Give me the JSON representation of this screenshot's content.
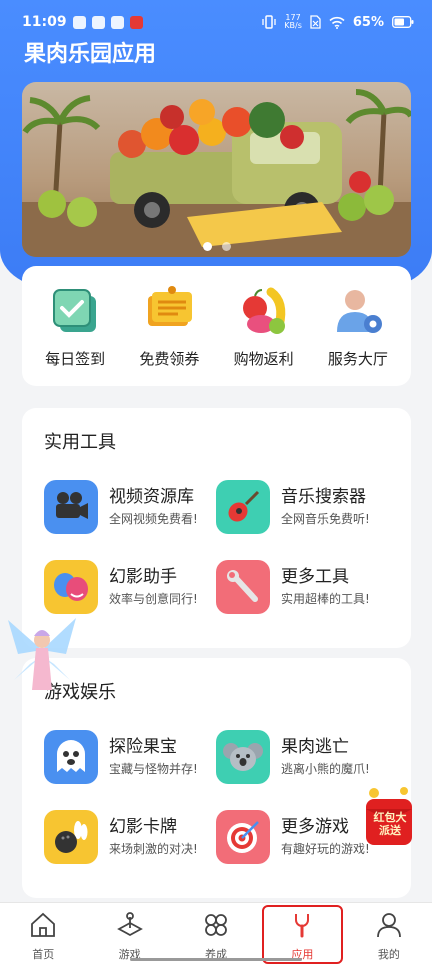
{
  "status_bar": {
    "time": "11:09",
    "net_speed": "177",
    "net_unit": "KB/s",
    "battery": "65%"
  },
  "app": {
    "title": "果肉乐园应用"
  },
  "banner": {
    "slides": 2,
    "active_index": 0
  },
  "quick_actions": [
    {
      "label": "每日签到",
      "icon": "checkin-icon"
    },
    {
      "label": "免费领券",
      "icon": "coupon-icon"
    },
    {
      "label": "购物返利",
      "icon": "fruit-basket-icon"
    },
    {
      "label": "服务大厅",
      "icon": "service-user-icon"
    }
  ],
  "tools_section": {
    "title": "实用工具",
    "items": [
      {
        "name": "视频资源库",
        "desc": "全网视频免费看!",
        "icon": "video-camera-icon",
        "color": "#4a90f0"
      },
      {
        "name": "音乐搜索器",
        "desc": "全网音乐免费听!",
        "icon": "guitar-icon",
        "color": "#3ecfb2"
      },
      {
        "name": "幻影助手",
        "desc": "效率与创意同行!",
        "icon": "masks-icon",
        "color": "#f7c531"
      },
      {
        "name": "更多工具",
        "desc": "实用超棒的工具!",
        "icon": "wrench-icon",
        "color": "#f26d78"
      }
    ]
  },
  "games_section": {
    "title": "游戏娱乐",
    "items": [
      {
        "name": "探险果宝",
        "desc": "宝藏与怪物并存!",
        "icon": "ghost-icon",
        "color": "#4a90f0"
      },
      {
        "name": "果肉逃亡",
        "desc": "逃离小熊的魔爪!",
        "icon": "koala-icon",
        "color": "#3ecfb2"
      },
      {
        "name": "幻影卡牌",
        "desc": "来场刺激的对决!",
        "icon": "bowling-icon",
        "color": "#f7c531"
      },
      {
        "name": "更多游戏",
        "desc": "有趣好玩的游戏!",
        "icon": "target-icon",
        "color": "#f26d78"
      }
    ]
  },
  "floating": {
    "red_packet_text": "红包大派送"
  },
  "tabs": [
    {
      "label": "首页",
      "icon": "home-icon"
    },
    {
      "label": "游戏",
      "icon": "joystick-icon"
    },
    {
      "label": "养成",
      "icon": "clover-icon"
    },
    {
      "label": "应用",
      "icon": "wrench-tab-icon",
      "active": true
    },
    {
      "label": "我的",
      "icon": "profile-icon"
    }
  ],
  "colors": {
    "header_blue": "#4a8dff",
    "active_tab": "#e53935"
  }
}
